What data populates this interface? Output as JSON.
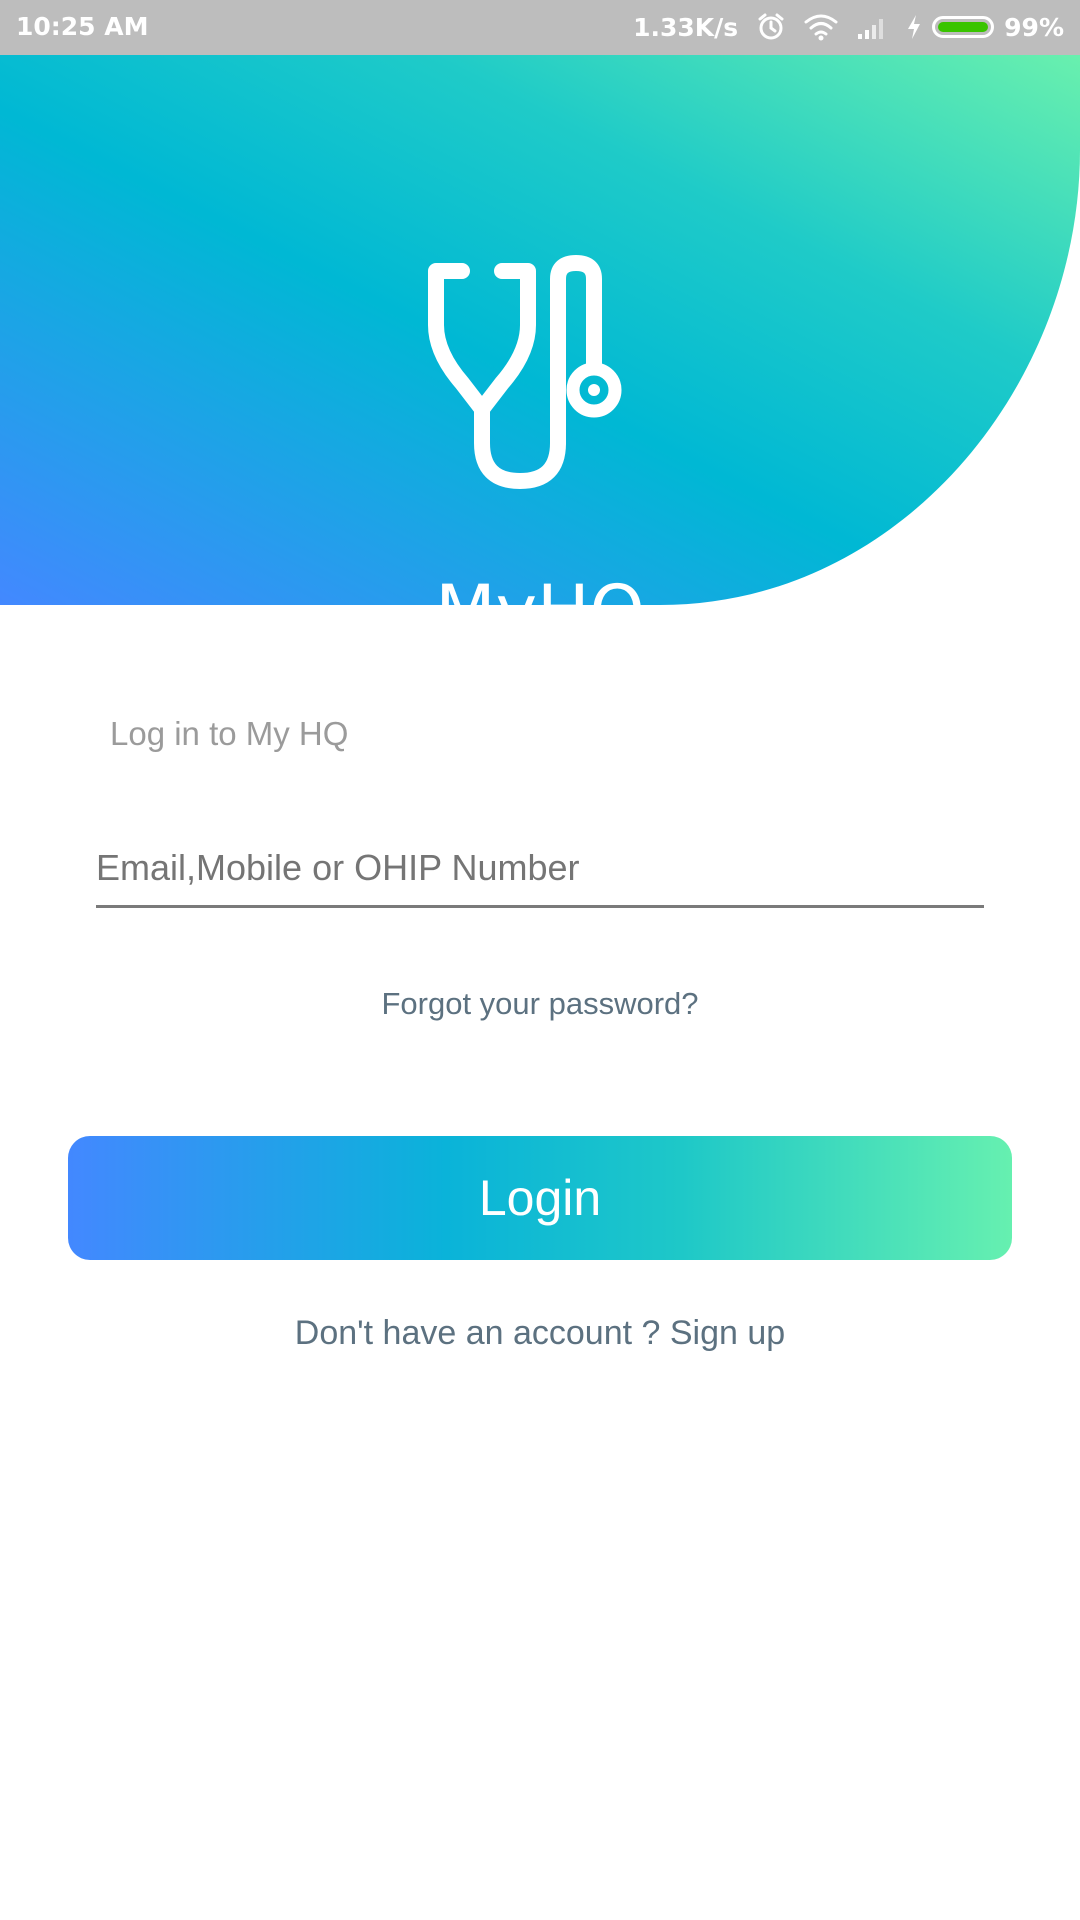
{
  "status_bar": {
    "time": "10:25 AM",
    "net_speed": "1.33K/s",
    "battery_percent": "99%",
    "battery_level": 0.99,
    "battery_color": "#39c400"
  },
  "header": {
    "app_name": "MyHQ",
    "logo_icon": "stethoscope-icon",
    "gradient_colors": [
      "#4388ff",
      "#00b8d4",
      "#69f0ae"
    ]
  },
  "form": {
    "heading": "Log in to My HQ",
    "email_placeholder": "Email,Mobile or OHIP Number",
    "email_value": "",
    "forgot_password": "Forgot your password?",
    "login_label": "Login",
    "signup_prompt": "Don't have an account ?",
    "signup_link": "Sign up"
  },
  "colors": {
    "link_text": "#5c7180",
    "heading_text": "#9b9b9b"
  }
}
